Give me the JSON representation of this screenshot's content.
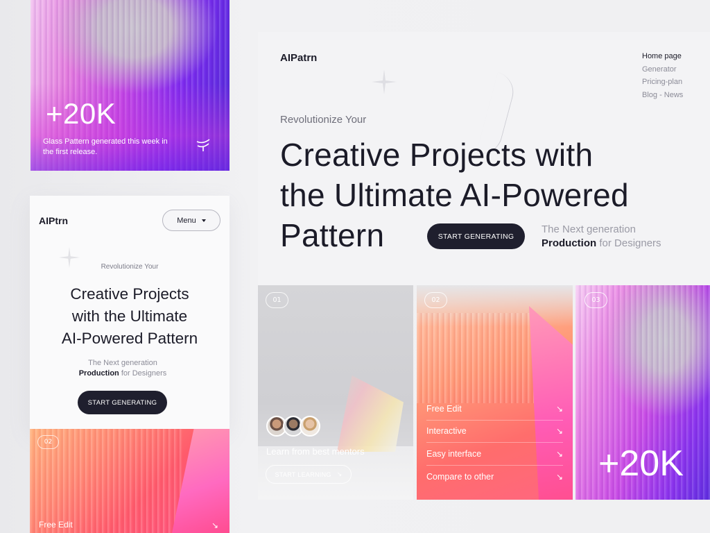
{
  "stat_card": {
    "value": "+20K",
    "caption": "Glass Pattern generated this week in the first release."
  },
  "mobile": {
    "brand": "AIPtrn",
    "menu_label": "Menu",
    "eyebrow": "Revolutionize Your",
    "headline": [
      "Creative Projects",
      "with the Ultimate",
      "AI-Powered Pattern"
    ],
    "sub_line1": "The Next generation",
    "sub_line2_bold": "Production",
    "sub_line2_rest": "for Designers",
    "cta": "START GENERATING"
  },
  "mobile_feature": {
    "number": "02",
    "label": "Free Edit",
    "arrow": "↘"
  },
  "desktop": {
    "brand": "AIPatrn",
    "nav": [
      {
        "label": "Home page",
        "active": true
      },
      {
        "label": "Generator",
        "active": false
      },
      {
        "label": "Pricing-plan",
        "active": false
      },
      {
        "label": "Blog - News",
        "active": false
      }
    ],
    "eyebrow": "Revolutionize Your",
    "headline_lines": [
      "Creative Projects with",
      "the Ultimate AI-Powered",
      "Pattern"
    ],
    "cta": "START GENERATING",
    "sub_line1": "The Next generation",
    "sub_line2_bold": "Production",
    "sub_line2_rest": "for Designers"
  },
  "mentor_card": {
    "number": "01",
    "title": "Learn from best mentors",
    "button": "START LEARNING",
    "button_arrow": "↘"
  },
  "features_card": {
    "number": "02",
    "items": [
      {
        "label": "Free Edit",
        "arrow": "↘"
      },
      {
        "label": "Interactive",
        "arrow": "↘"
      },
      {
        "label": "Easy interface",
        "arrow": "↘"
      },
      {
        "label": "Compare to other",
        "arrow": "↘"
      }
    ]
  },
  "stat_card_right": {
    "number": "03",
    "value": "+20K"
  },
  "colors": {
    "dark_button": "#1f1f2e",
    "text_dark": "#1b1b28",
    "text_muted": "#8b8b97",
    "page_bg": "#f0f0f2"
  }
}
